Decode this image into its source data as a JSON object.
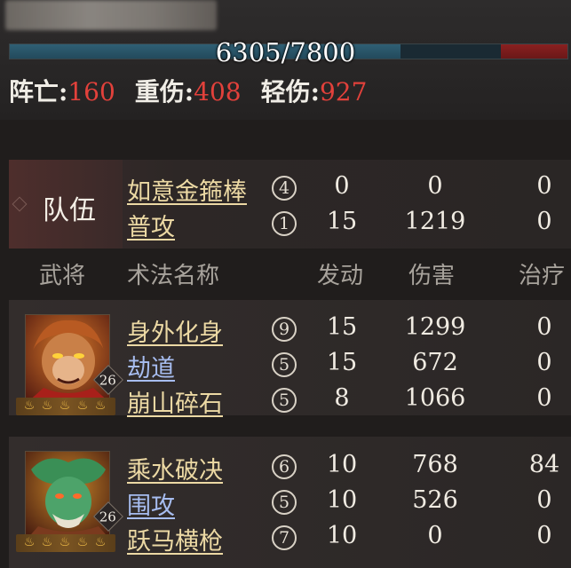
{
  "hp": {
    "current_max": "6305/7800",
    "fill_fraction": 0.7,
    "damage_fraction": 0.12
  },
  "stats": {
    "dead_label": "阵亡:",
    "dead_value": "160",
    "heavy_label": "重伤:",
    "heavy_value": "408",
    "light_label": "轻伤:",
    "light_value": "927"
  },
  "team": {
    "label": "队伍",
    "rows": [
      {
        "skill": "如意金箍棒",
        "grade": "4",
        "triggers": "0",
        "damage": "0",
        "heal": "0"
      },
      {
        "skill": "普攻",
        "grade": "1",
        "triggers": "15",
        "damage": "1219",
        "heal": "0"
      }
    ]
  },
  "columns": {
    "general": "武将",
    "skill": "术法名称",
    "triggers": "发动",
    "damage": "伤害",
    "heal": "治疗"
  },
  "generals": [
    {
      "level": "26",
      "stars": 5,
      "rows": [
        {
          "skill": "身外化身",
          "grade": "9",
          "triggers": "15",
          "damage": "1299",
          "heal": "0",
          "color": "gold"
        },
        {
          "skill": "劫道",
          "grade": "5",
          "triggers": "15",
          "damage": "672",
          "heal": "0",
          "color": "blue"
        },
        {
          "skill": "崩山碎石",
          "grade": "5",
          "triggers": "8",
          "damage": "1066",
          "heal": "0",
          "color": "gold"
        }
      ]
    },
    {
      "level": "26",
      "stars": 5,
      "rows": [
        {
          "skill": "乘水破决",
          "grade": "6",
          "triggers": "10",
          "damage": "768",
          "heal": "84",
          "color": "gold"
        },
        {
          "skill": "围攻",
          "grade": "5",
          "triggers": "10",
          "damage": "526",
          "heal": "0",
          "color": "blue"
        },
        {
          "skill": "跃马横枪",
          "grade": "7",
          "triggers": "10",
          "damage": "0",
          "heal": "0",
          "color": "gold"
        }
      ]
    }
  ],
  "colors": {
    "accent_red": "#e2413b",
    "skill_gold": "#ecd9a4",
    "skill_blue": "#a7bdf0",
    "star": "#f5c24a"
  }
}
